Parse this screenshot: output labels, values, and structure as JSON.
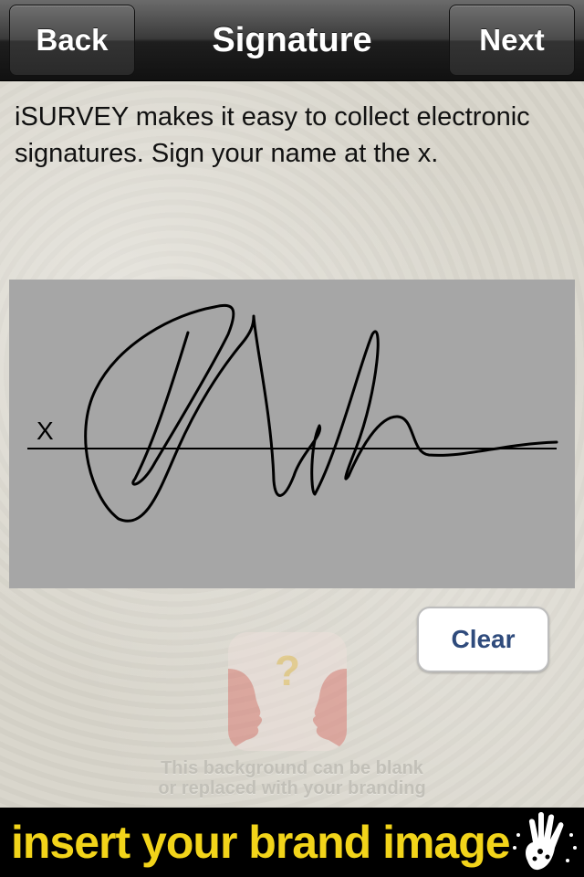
{
  "navbar": {
    "back_label": "Back",
    "title": "Signature",
    "next_label": "Next"
  },
  "instructions": "iSURVEY makes it easy to collect electronic signatures. Sign your name at the x.",
  "signature_pad": {
    "x_marker": "X",
    "background": "#a6a6a6"
  },
  "clear_label": "Clear",
  "logo_icon": "question-faces-logo-icon",
  "branding_note": {
    "line1": "This background can be blank",
    "line2": "or replaced with your branding"
  },
  "brand_banner": {
    "text": "insert your brand image",
    "text_color": "#f2d41a",
    "icon": "handprint-icon"
  }
}
